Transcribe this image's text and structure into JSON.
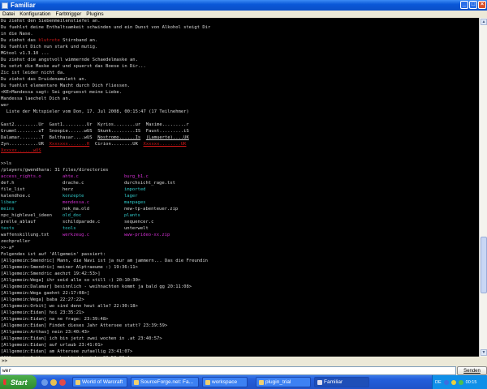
{
  "window": {
    "title": "Familiar"
  },
  "menu": [
    "Datei",
    "Konfiguration",
    "Farbtrigger",
    "Plugins"
  ],
  "terminal": {
    "lines": [
      [
        {
          "t": "Du ziehst den Siebenmeilenstiefel an."
        }
      ],
      [
        {
          "t": "Du fuehlst deine Enthaltsamkeit schwinden und ein Dunst von Alkohol steigt Dir"
        }
      ],
      [
        {
          "t": "in die Nase."
        }
      ],
      [
        {
          "t": "Du ziehst das "
        },
        {
          "t": "blutrote",
          "c": "red"
        },
        {
          "t": " Stirnband an."
        }
      ],
      [
        {
          "t": "Du fuehlst Dich nun stark und mutig."
        }
      ],
      [
        {
          "t": "MGtool v1.3.10 ..."
        }
      ],
      [
        {
          "t": "Du ziehst die angstvoll wimmernde Schaedelmaske an."
        }
      ],
      [
        {
          "t": "Du setzt die Maske auf und spuerst das Boese in Dir..."
        }
      ],
      [
        {
          "t": "Zic ist leider nicht da."
        }
      ],
      [
        {
          "t": "Du ziehst das Druidenamulett an."
        }
      ],
      [
        {
          "t": "Du fuehlst elementare Macht durch Dich fliessen."
        }
      ],
      [
        {
          "t": "<KE>Mandessa sagt: Sei gegruesst meine Liebe."
        }
      ],
      [
        {
          "t": "Mandessa laechelt Dich an."
        }
      ],
      [
        {
          "t": "wer"
        }
      ],
      [
        {
          "t": "  Liste der Mitspieler vom Don, 17. Jul 2008, 00:15:47 (17 Teilnehmer)"
        }
      ],
      [],
      [
        {
          "t": "Gast2.........Ur  Gast1.........Ur  Kyrios........ur  Maxime.........r"
        }
      ],
      [
        {
          "t": "Grumml........uT  Snoopie......wUS  Skunk.........IS  Faust.........iS"
        }
      ],
      [
        {
          "t": "Dalamar........T  Balthasar....wUS  "
        },
        {
          "t": "Nostromo......Is",
          "u": true
        },
        {
          "t": "  "
        },
        {
          "t": "(Lamuerte)....UK",
          "u": true
        }
      ],
      [
        {
          "t": "Zyn...........UR  "
        },
        {
          "t": "Xxxxxxx.......R",
          "c": "red",
          "u": true
        },
        {
          "t": "  Cirion........UK  "
        },
        {
          "t": "Xxxxxx........UK",
          "c": "red",
          "u": true
        }
      ],
      [
        {
          "t": "Xxxxxx......wUS",
          "c": "red",
          "u": true
        }
      ],
      [],
      [
        {
          "t": ">>ls"
        }
      ],
      [
        {
          "t": "/players/gwendhara: 31 files/directories"
        }
      ],
      [
        {
          "col": [
            {
              "t": "access_rights.o",
              "c": "mag"
            },
            {
              "t": "ahte.c",
              "c": "mag"
            },
            {
              "t": "burg_b1.c",
              "c": "mag"
            }
          ]
        }
      ],
      [
        {
          "col": [
            {
              "t": "def.h"
            },
            {
              "t": "drache.c"
            },
            {
              "t": "durchsicht_rage.txt"
            }
          ]
        }
      ],
      [
        {
          "col": [
            {
              "t": "file_list"
            },
            {
              "t": "herz"
            },
            {
              "t": "imported",
              "c": "cyan"
            }
          ]
        }
      ],
      [
        {
          "col": [
            {
              "t": "kalendhoe.c"
            },
            {
              "t": "konzepte",
              "c": "cyan"
            },
            {
              "t": "lager",
              "c": "cyan"
            }
          ]
        }
      ],
      [
        {
          "col": [
            {
              "t": "libear",
              "c": "cyan"
            },
            {
              "t": "mendessa.c",
              "c": "mag"
            },
            {
              "t": "manpages",
              "c": "cyan"
            }
          ]
        }
      ],
      [
        {
          "col": [
            {
              "t": "meins",
              "c": "cyan"
            },
            {
              "t": "nek_ma.old"
            },
            {
              "t": "new-tp-abenteuer.zip"
            }
          ]
        }
      ],
      [
        {
          "col": [
            {
              "t": "npc_highlevel_ideen"
            },
            {
              "t": "old_doc",
              "c": "cyan"
            },
            {
              "t": "plants",
              "c": "cyan"
            }
          ]
        }
      ],
      [
        {
          "col": [
            {
              "t": "prelle_ablauf"
            },
            {
              "t": "schildparade.c"
            },
            {
              "t": "sequencer.c"
            }
          ]
        }
      ],
      [
        {
          "col": [
            {
              "t": "tests",
              "c": "cyan"
            },
            {
              "t": "tools",
              "c": "cyan"
            },
            {
              "t": "unterwelt"
            }
          ]
        }
      ],
      [
        {
          "col": [
            {
              "t": "waffenskillung.txt"
            },
            {
              "t": "werkzeug.c",
              "c": "mag"
            },
            {
              "t": "www-prideo-xx.zip",
              "c": "mag"
            }
          ]
        }
      ],
      [
        {
          "t": "zechpreller"
        }
      ],
      [
        {
          "t": ">>-a*"
        }
      ],
      [
        {
          "t": "Folgendes ist auf 'Allgemein' passiert:"
        }
      ],
      [
        {
          "t": "[Allgemein:Smendric] Mann, die Navi ist ja nur am jammern... Das die Freundin"
        }
      ],
      [
        {
          "t": "[Allgemein:Smendric] meiner Alptraeume :) 19:36:11>"
        }
      ],
      [
        {
          "t": "[Allgemein:Smendric aechzt 19:42:53>]"
        }
      ],
      [
        {
          "t": "[Allgemein:Wega] ihr seid alle so still :) 20:10:30>"
        }
      ],
      [
        {
          "t": "[Allgemein:Dalamar] besinnlich - weihnachten kommt ja bald gg 20:11:08>"
        }
      ],
      [
        {
          "t": "[Allgemein:Wega gaehnt 22:17:08>]"
        }
      ],
      [
        {
          "t": "[Allgemein:Wega] baba 22:27:22>"
        }
      ],
      [
        {
          "t": "[Allgemein:Orbit] wo sind denn heut alle? 22:30:18>"
        }
      ],
      [
        {
          "t": "[Allgemein:Eidan] hoi 23:35:21>"
        }
      ],
      [
        {
          "t": "[Allgemein:Eidan] na ne frage: 23:39:48>"
        }
      ],
      [
        {
          "t": "[Allgemein:Eidan] Findet dieses Jahr Attersee statt? 23:39:59>"
        }
      ],
      [
        {
          "t": "[Allgemein:Arthas] nein 23:40:43>"
        }
      ],
      [
        {
          "t": "[Allgemein:Eidan] ich bin jetzt zwei wochen in .at 23:40:57>"
        }
      ],
      [
        {
          "t": "[Allgemein:Eidan] auf urlaub 23:41:01>"
        }
      ],
      [
        {
          "t": "[Allgemein:Eidan] am Attersee zufaellig 23:41:07>"
        }
      ],
      [
        {
          "t": "[Allgemein:Arthas verabschiedet sich. 23:52:08>]"
        }
      ]
    ]
  },
  "status": {
    "prompt": ">>"
  },
  "input": {
    "value": "wer"
  },
  "send_label": "Senden",
  "taskbar": {
    "start": "Start",
    "tasks": [
      "World of Warcraft",
      "SourceForge.net: Fa...",
      "workspace",
      "plugin_trial",
      "Familiar"
    ],
    "active": "Familiar",
    "tray_lang": "DE",
    "clock": "00:15"
  },
  "colors": {
    "red": "#d01818",
    "magenta": "#d030d0",
    "cyan": "#30c8c8",
    "terminal_bg": "#000000"
  }
}
